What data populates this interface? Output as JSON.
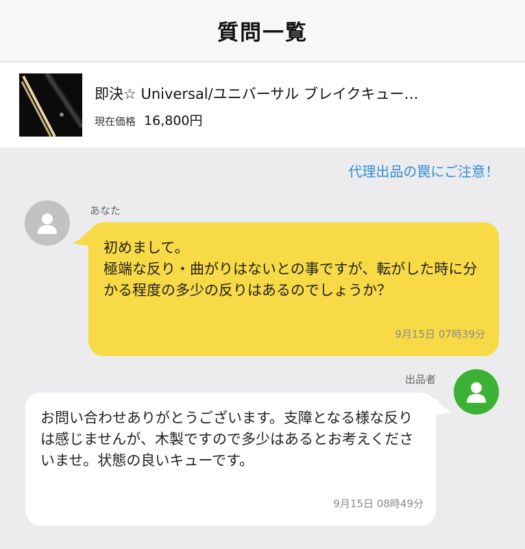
{
  "header": {
    "title": "質問一覧"
  },
  "item": {
    "title": "即決☆ Universal/ユニバーサル ブレイクキュー…",
    "price_label": "現在価格",
    "price_value": "16,800円"
  },
  "notice": {
    "link_text": "代理出品の罠にご注意！"
  },
  "colors": {
    "accent_link": "#2e8fd6",
    "my_bubble": "#f8d946",
    "seller_avatar": "#3bb233",
    "my_avatar": "#c2c2c2"
  },
  "messages": [
    {
      "sender": "あなた",
      "text": "初めまして。\n極端な反り・曲がりはないとの事ですが、転がした時に分かる程度の多少の反りはあるのでしょうか？",
      "time": "9月15日 07時39分",
      "avatar_icon": "person-icon"
    },
    {
      "sender": "出品者",
      "text": "お問い合わせありがとうございます。支障となる様な反りは感じませんが、木製ですので多少はあるとお考えくださいませ。状態の良いキューです。",
      "time": "9月15日 08時49分",
      "avatar_icon": "person-icon"
    }
  ]
}
